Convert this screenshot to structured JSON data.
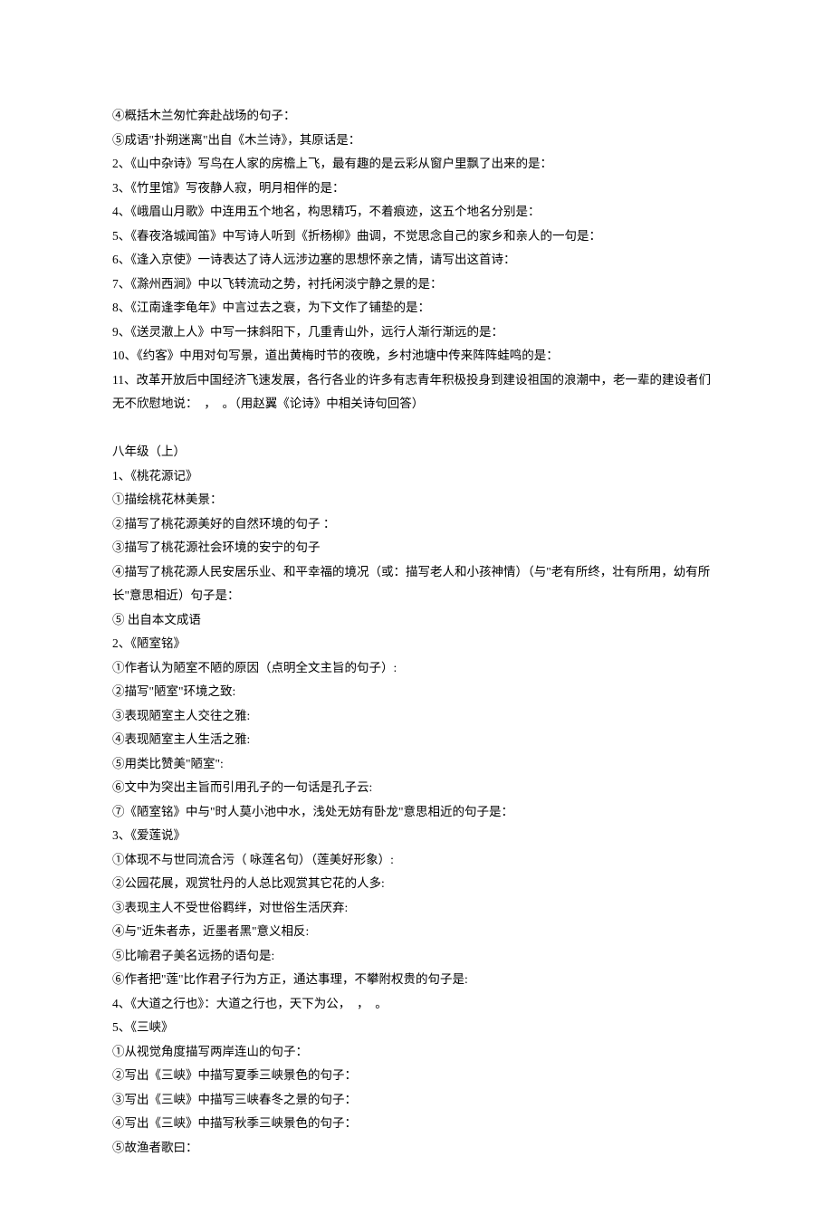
{
  "lines": [
    "④概括木兰匆忙奔赴战场的句子：",
    "⑤成语\"扑朔迷离\"出自《木兰诗》，其原话是：",
    "2、《山中杂诗》写鸟在人家的房檐上飞，最有趣的是云彩从窗户里飘了出来的是：",
    "3、《竹里馆》写夜静人寂，明月相伴的是：",
    "4、《峨眉山月歌》中连用五个地名，构思精巧，不着痕迹，这五个地名分别是：",
    "5、《春夜洛城闻笛》中写诗人听到《折杨柳》曲调，不觉思念自己的家乡和亲人的一句是：",
    "6、《逢入京使》一诗表达了诗人远涉边塞的思想怀亲之情，请写出这首诗：",
    "7、《滁州西涧》中以飞转流动之势，衬托闲淡宁静之景的是：",
    "8、《江南逢李龟年》中言过去之衰，为下文作了铺垫的是：",
    "9、《送灵澈上人》中写一抹斜阳下，几重青山外，远行人渐行渐远的是：",
    "10、《约客》中用对句写景，道出黄梅时节的夜晚，乡村池塘中传来阵阵蛙鸣的是：",
    "11、改革开放后中国经济飞速发展，各行各业的许多有志青年积极投身到建设祖国的浪潮中，老一辈的建设者们无不欣慰地说：　，　。（用赵翼《论诗》中相关诗句回答）"
  ],
  "section_title": "八年级（上）",
  "section_lines": [
    "1、《桃花源记》",
    "①描绘桃花林美景：",
    "②描写了桃花源美好的自然环境的句子 ：",
    "③描写了桃花源社会环境的安宁的句子",
    "④描写了桃花源人民安居乐业、和平幸福的境况（或：描写老人和小孩神情）（与\"老有所终，壮有所用，幼有所长\"意思相近）句子是：",
    "⑤  出自本文成语",
    "2、《陋室铭》",
    "①作者认为陋室不陋的原因（点明全文主旨的句子）:",
    "②描写\"陋室\"环境之致:",
    "③表现陋室主人交往之雅:",
    "④表现陋室主人生活之雅:",
    "⑤用类比赞美\"陋室\":",
    "⑥文中为突出主旨而引用孔子的一句话是孔子云:",
    "⑦《陋室铭》中与\"时人莫小池中水，浅处无妨有卧龙\"意思相近的句子是：",
    "3、《爱莲说》",
    "①体现不与世同流合污（ 咏莲名句）（莲美好形象）:",
    "②公园花展，观赏牡丹的人总比观赏其它花的人多:",
    "③表现主人不受世俗羁绊，对世俗生活厌弃:",
    "④与\"近朱者赤，近墨者黑\"意义相反:",
    "⑤比喻君子美名远扬的语句是:",
    "⑥作者把\"莲\"比作君子行为方正，通达事理，不攀附权贵的句子是:",
    "4、《大道之行也》：大道之行也，天下为公，　，　。",
    "5、《三峡》",
    "①从视觉角度描写两岸连山的句子：",
    "②写出《三峡》中描写夏季三峡景色的句子：",
    "③写出《三峡》中描写三峡春冬之景的句子：",
    "④写出《三峡》中描写秋季三峡景色的句子：",
    "⑤故渔者歌曰："
  ]
}
